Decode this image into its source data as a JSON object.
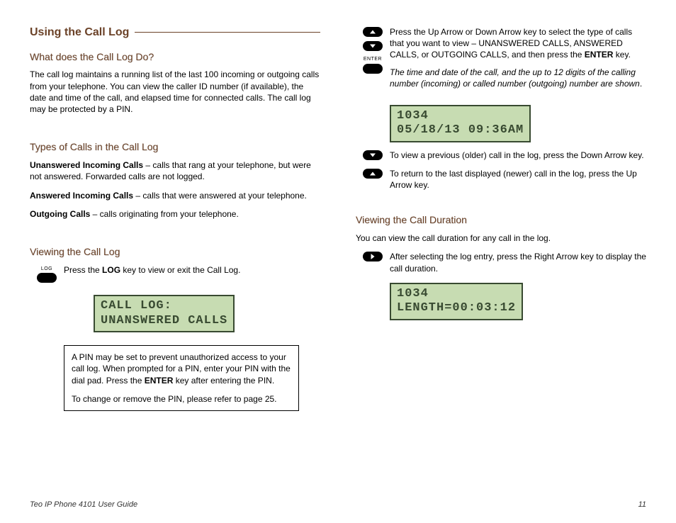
{
  "left": {
    "title": "Using the Call Log",
    "s1_title": "What does the Call Log Do?",
    "s1_body": "The call log maintains a running list of the last 100 incoming or outgoing calls from your telephone. You can view the caller ID number (if available), the date and time of the call, and elapsed time for connected calls. The call log may be protected by a PIN.",
    "s2_title": "Types of Calls in the Call Log",
    "types": {
      "t1_bold": "Unanswered Incoming Calls",
      "t1_rest": " – calls that rang at your telephone, but were not answered. Forwarded calls are not logged.",
      "t2_bold": "Answered Incoming Calls",
      "t2_rest": " – calls that were answered at your telephone.",
      "t3_bold": "Outgoing Calls",
      "t3_rest": " – calls originating from your telephone."
    },
    "s3_title": "Viewing the Call Log",
    "log_key_label": "LOG",
    "log_instr_pre": "Press the ",
    "log_instr_bold": "LOG",
    "log_instr_post": " key to view or exit the Call Log.",
    "lcd1_l1": "CALL LOG:",
    "lcd1_l2": "UNANSWERED CALLS",
    "note_p1_pre": "A PIN may be set to prevent unauthorized access to your call log. When prompted for a PIN, enter your PIN with the dial pad. Press the ",
    "note_p1_bold": "ENTER",
    "note_p1_post": " key after entering the PIN.",
    "note_p2": "To change or remove the PIN, please refer to page 25."
  },
  "right": {
    "enter_label": "ENTER",
    "up_instr_pre": "Press the Up Arrow or Down Arrow key to select the type of calls that you want to view – UNANSWERED CALLS,  ANSWERED CALLS, or OUTGOING CALLS, and then press the ",
    "up_instr_bold": "ENTER",
    "up_instr_post": " key.",
    "note_italic": "The time and date of the call, and the up to 12 digits of the calling number (incoming) or called number (outgoing) number are shown",
    "note_italic_dot": ".",
    "lcd2_l1": "1034",
    "lcd2_l2": "05/18/13 09:36AM",
    "down_text": "To view a previous (older) call in the log, press the Down Arrow key.",
    "up_text": "To return to the last displayed (newer) call in the log, press the Up Arrow key.",
    "s4_title": "Viewing the Call Duration",
    "s4_intro": "You can view the call duration for any call in the log.",
    "right_text": "After selecting the log entry, press the Right Arrow key to display the call duration.",
    "lcd3_l1": "1034",
    "lcd3_l2": "LENGTH=00:03:12"
  },
  "footer": {
    "left": "Teo IP Phone 4101 User Guide",
    "right": "11"
  }
}
